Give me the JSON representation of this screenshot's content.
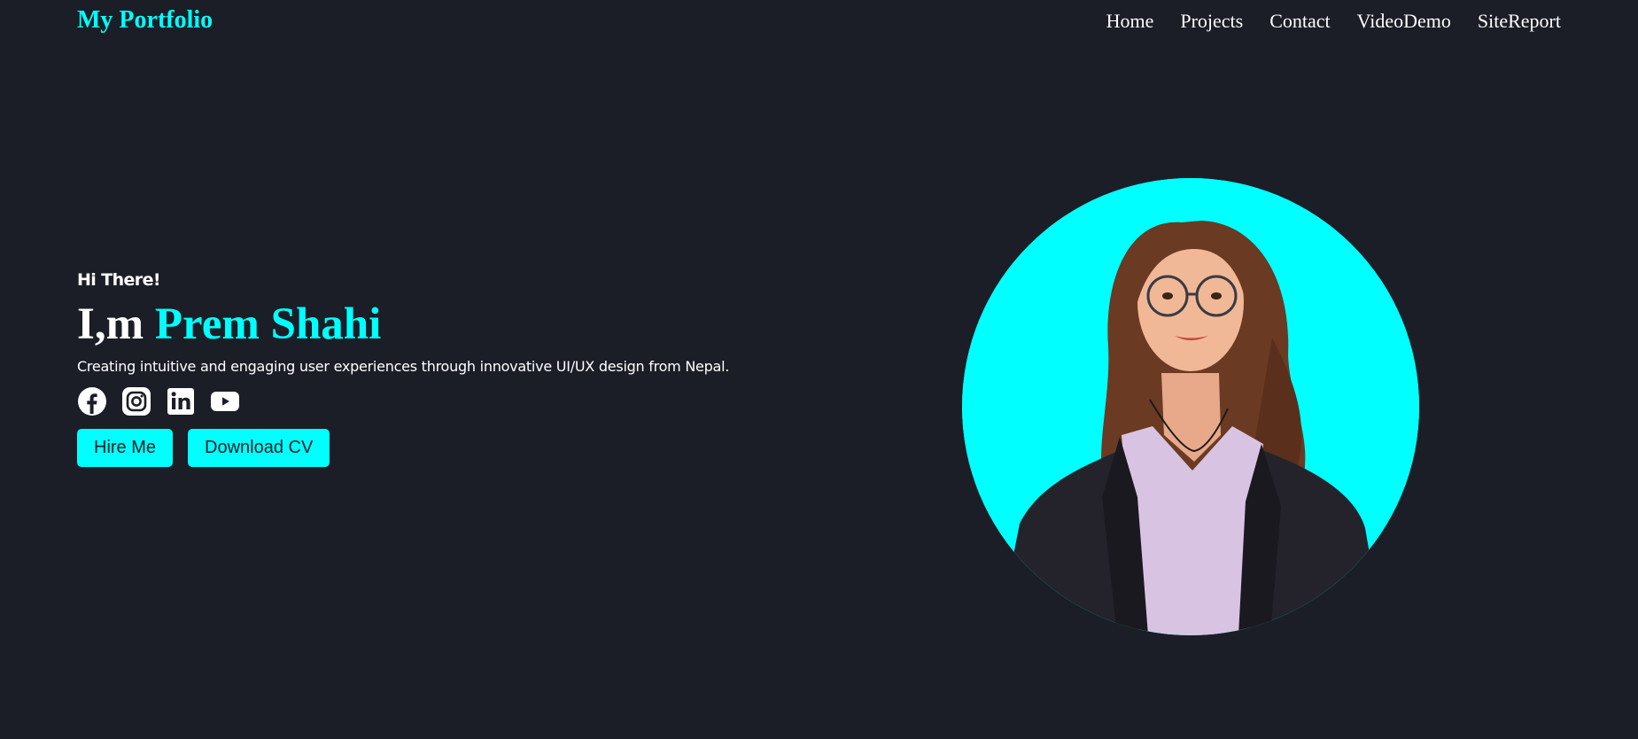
{
  "header": {
    "logo": "My Portfolio",
    "nav": [
      "Home",
      "Projects",
      "Contact",
      "VideoDemo",
      "SiteReport"
    ]
  },
  "hero": {
    "greeting": "Hi There!",
    "intro": "I,m",
    "name": "Prem Shahi",
    "tagline": "Creating intuitive and engaging user experiences through innovative UI/UX design from Nepal.",
    "buttons": {
      "hire": "Hire Me",
      "download": "Download CV"
    }
  },
  "socials": [
    "facebook-icon",
    "instagram-icon",
    "linkedin-icon",
    "youtube-icon"
  ],
  "colors": {
    "accent": "#00ffff",
    "background": "#1b1e26",
    "text": "#ffffff"
  }
}
